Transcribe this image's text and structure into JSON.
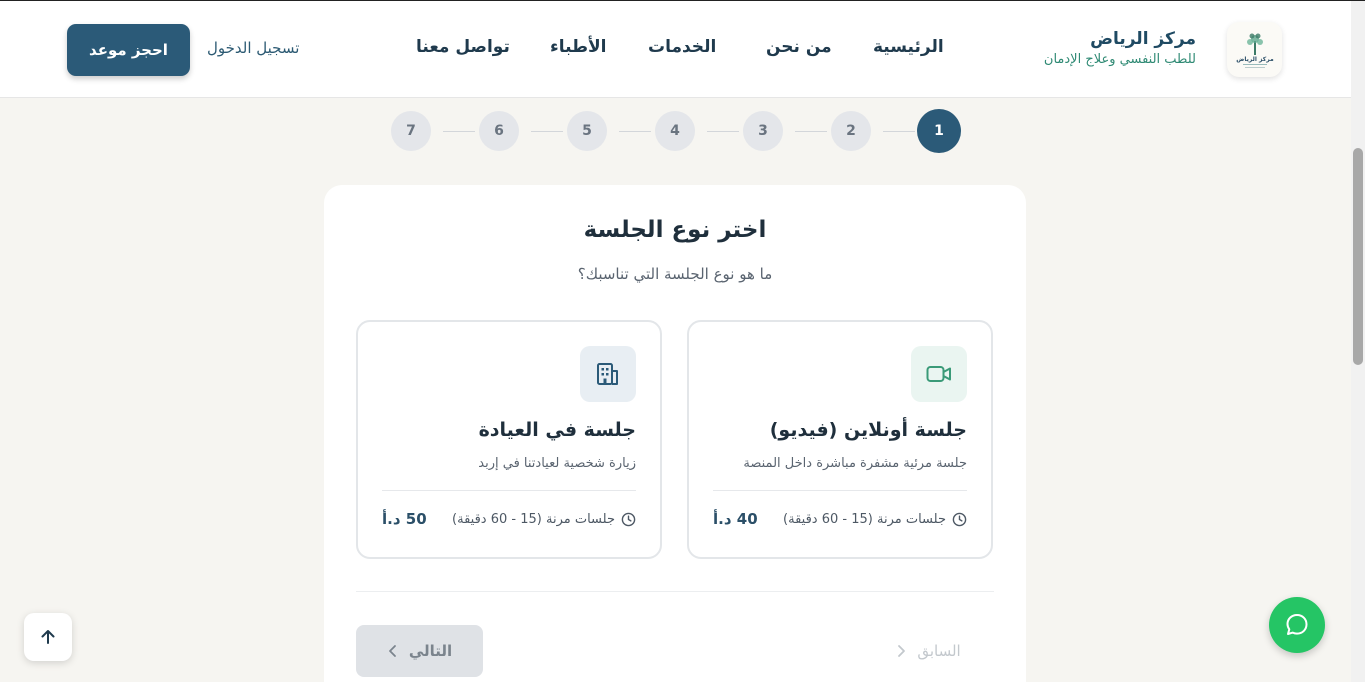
{
  "header": {
    "brand_name": "مركز الرياض",
    "brand_sub": "للطب النفسي وعلاج الإدمان",
    "logo_text": "مركز الرياض",
    "nav": [
      {
        "label": "الرئيسية"
      },
      {
        "label": "من نحن"
      },
      {
        "label": "الخدمات"
      },
      {
        "label": "الأطباء"
      },
      {
        "label": "تواصل معنا"
      }
    ],
    "login_label": "تسجيل الدخول",
    "book_label": "احجز موعد"
  },
  "stepper": {
    "steps": [
      "1",
      "2",
      "3",
      "4",
      "5",
      "6",
      "7"
    ],
    "current": 1
  },
  "card": {
    "title": "اختر نوع الجلسة",
    "subtitle": "ما هو نوع الجلسة التي تناسبك؟",
    "options": [
      {
        "icon": "video-camera-icon",
        "title": "جلسة أونلاين (فيديو)",
        "description": "جلسة مرئية مشفرة مباشرة داخل المنصة",
        "duration": "جلسات مرنة (15 - 60 دقيقة)",
        "price": "40 د.أ"
      },
      {
        "icon": "building-icon",
        "title": "جلسة في العيادة",
        "description": "زيارة شخصية لعيادتنا في إربد",
        "duration": "جلسات مرنة (15 - 60 دقيقة)",
        "price": "50 د.أ"
      }
    ],
    "prev_label": "السابق",
    "next_label": "التالي"
  },
  "colors": {
    "primary": "#2b5a78",
    "accent_green": "#2f8a74",
    "whatsapp": "#25c565",
    "background": "#f6f5f1"
  }
}
